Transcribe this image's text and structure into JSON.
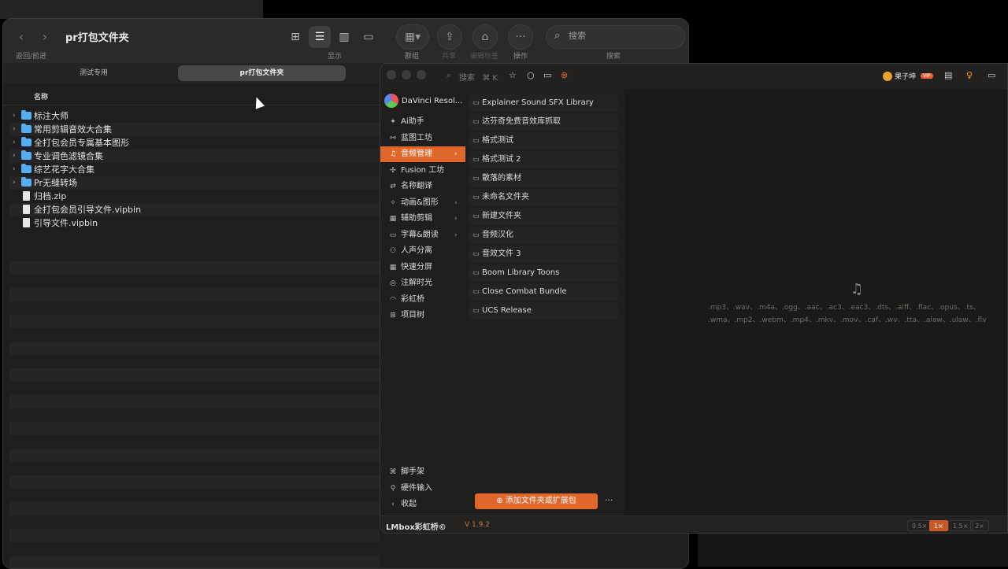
{
  "finder": {
    "title": "pr打包文件夹",
    "nav_label": "返回/前进",
    "view_label": "显示",
    "group_label": "群组",
    "share_label": "共享",
    "tags_label": "编辑标签",
    "action_label": "操作",
    "search_label": "搜索",
    "search_placeholder": "搜索",
    "tabs": [
      {
        "label": "测试专用"
      },
      {
        "label": "pr打包文件夹"
      }
    ],
    "column_name": "名称",
    "files": [
      {
        "name": "标注大师",
        "type": "folder"
      },
      {
        "name": "常用剪辑音效大合集",
        "type": "folder"
      },
      {
        "name": "全打包会员专属基本图形",
        "type": "folder"
      },
      {
        "name": "专业调色滤镜合集",
        "type": "folder"
      },
      {
        "name": "综艺花字大合集",
        "type": "folder"
      },
      {
        "name": "Pr无缝转场",
        "type": "folder"
      },
      {
        "name": "归档.zip",
        "type": "file"
      },
      {
        "name": "全打包会员引导文件.vipbin",
        "type": "file"
      },
      {
        "name": "引导文件.vipbin",
        "type": "file"
      }
    ]
  },
  "plugin": {
    "search_placeholder": "搜索",
    "search_shortcut": "⌘ K",
    "user_name": "果子坤",
    "vip_badge": "VIP",
    "app_name": "DaVinci Resol...",
    "sidebar": [
      {
        "label": "Ai助手",
        "icon": "ai-icon",
        "glyph": "✦"
      },
      {
        "label": "蓝图工坊",
        "icon": "blueprint-icon",
        "glyph": "⚯"
      },
      {
        "label": "音频管理",
        "icon": "headphones-icon",
        "glyph": "♫",
        "active": true,
        "arrow": "›"
      },
      {
        "label": "Fusion 工坊",
        "icon": "fusion-icon",
        "glyph": "✣"
      },
      {
        "label": "名称翻译",
        "icon": "translate-icon",
        "glyph": "⇄"
      },
      {
        "label": "动画&图形",
        "icon": "animation-icon",
        "glyph": "✧",
        "arrow": "›"
      },
      {
        "label": "辅助剪辑",
        "icon": "edit-assist-icon",
        "glyph": "▦",
        "arrow": "›"
      },
      {
        "label": "字幕&朗读",
        "icon": "subtitle-icon",
        "glyph": "▭",
        "arrow": "›"
      },
      {
        "label": "人声分离",
        "icon": "vocal-icon",
        "glyph": "⚇"
      },
      {
        "label": "快速分屏",
        "icon": "split-icon",
        "glyph": "▦"
      },
      {
        "label": "注解时光",
        "icon": "annotate-icon",
        "glyph": "◎"
      },
      {
        "label": "彩虹桥",
        "icon": "rainbow-icon",
        "glyph": "◠"
      },
      {
        "label": "项目树",
        "icon": "tree-icon",
        "glyph": "⊞"
      }
    ],
    "sidebar_bottom": [
      {
        "label": "脚手架",
        "icon": "scaffold-icon",
        "glyph": "⌘"
      },
      {
        "label": "硬件输入",
        "icon": "hardware-icon",
        "glyph": "⚲"
      },
      {
        "label": "收起",
        "icon": "collapse-icon",
        "glyph": "‹"
      }
    ],
    "libraries": [
      "Explainer Sound SFX Library",
      "达芬奇免费音效库抓取",
      "格式测试",
      "格式测试 2",
      "散落的素材",
      "未命名文件夹",
      "新建文件夹",
      "音频汉化",
      "音效文件 3",
      "Boom Library Toons",
      "Close Combat Bundle",
      "UCS Release"
    ],
    "formats_line1": ".mp3、.wav、.m4a、.ogg、.aac、.ac3、.eac3、.dts、.aiff、.flac、.opus、.ts、",
    "formats_line2": ".wma、.mp2、.webm、.mp4、.mkv、.mov、.caf、.wv、.tta、.alaw、.ulaw、.flv",
    "add_button": "添加文件夹或扩展包",
    "more": "···",
    "brand": "LMbox彩虹桥©",
    "version": "V 1.9.2",
    "speeds": [
      {
        "label": "0.5×"
      },
      {
        "label": "1×",
        "active": true
      },
      {
        "label": "1.5×"
      },
      {
        "label": "2×"
      }
    ],
    "accent": "#e0662a"
  }
}
